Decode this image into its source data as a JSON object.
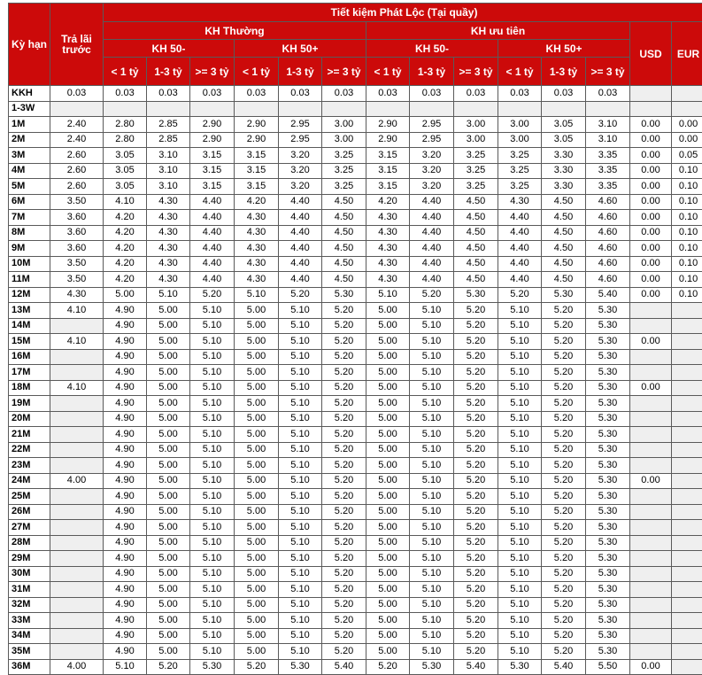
{
  "header": {
    "term": "Kỳ hạn",
    "prepaid": "Trả lãi trước",
    "product": "Tiết kiệm Phát Lộc (Tại quầy)",
    "normal": "KH Thường",
    "priority": "KH ưu tiên",
    "under50": "KH 50-",
    "over50": "KH 50+",
    "usd": "USD",
    "eur": "EUR",
    "lt1": "< 1 tỷ",
    "r13": "1-3 tỷ",
    "ge3": ">= 3 tỷ"
  },
  "rows": [
    {
      "term": "KKH",
      "prepaid": "0.03",
      "v": [
        "0.03",
        "0.03",
        "0.03",
        "0.03",
        "0.03",
        "0.03",
        "0.03",
        "0.03",
        "0.03",
        "0.03",
        "0.03",
        "0.03"
      ],
      "usd": "",
      "eur": ""
    },
    {
      "term": "1-3W",
      "prepaid": "",
      "v": [
        "",
        "",
        "",
        "",
        "",
        "",
        "",
        "",
        "",
        "",
        "",
        ""
      ],
      "usd": "",
      "eur": ""
    },
    {
      "term": "1M",
      "prepaid": "2.40",
      "v": [
        "2.80",
        "2.85",
        "2.90",
        "2.90",
        "2.95",
        "3.00",
        "2.90",
        "2.95",
        "3.00",
        "3.00",
        "3.05",
        "3.10"
      ],
      "usd": "0.00",
      "eur": "0.00"
    },
    {
      "term": "2M",
      "prepaid": "2.40",
      "v": [
        "2.80",
        "2.85",
        "2.90",
        "2.90",
        "2.95",
        "3.00",
        "2.90",
        "2.95",
        "3.00",
        "3.00",
        "3.05",
        "3.10"
      ],
      "usd": "0.00",
      "eur": "0.00"
    },
    {
      "term": "3M",
      "prepaid": "2.60",
      "v": [
        "3.05",
        "3.10",
        "3.15",
        "3.15",
        "3.20",
        "3.25",
        "3.15",
        "3.20",
        "3.25",
        "3.25",
        "3.30",
        "3.35"
      ],
      "usd": "0.00",
      "eur": "0.05"
    },
    {
      "term": "4M",
      "prepaid": "2.60",
      "v": [
        "3.05",
        "3.10",
        "3.15",
        "3.15",
        "3.20",
        "3.25",
        "3.15",
        "3.20",
        "3.25",
        "3.25",
        "3.30",
        "3.35"
      ],
      "usd": "0.00",
      "eur": "0.10"
    },
    {
      "term": "5M",
      "prepaid": "2.60",
      "v": [
        "3.05",
        "3.10",
        "3.15",
        "3.15",
        "3.20",
        "3.25",
        "3.15",
        "3.20",
        "3.25",
        "3.25",
        "3.30",
        "3.35"
      ],
      "usd": "0.00",
      "eur": "0.10"
    },
    {
      "term": "6M",
      "prepaid": "3.50",
      "v": [
        "4.10",
        "4.30",
        "4.40",
        "4.20",
        "4.40",
        "4.50",
        "4.20",
        "4.40",
        "4.50",
        "4.30",
        "4.50",
        "4.60"
      ],
      "usd": "0.00",
      "eur": "0.10"
    },
    {
      "term": "7M",
      "prepaid": "3.60",
      "v": [
        "4.20",
        "4.30",
        "4.40",
        "4.30",
        "4.40",
        "4.50",
        "4.30",
        "4.40",
        "4.50",
        "4.40",
        "4.50",
        "4.60"
      ],
      "usd": "0.00",
      "eur": "0.10"
    },
    {
      "term": "8M",
      "prepaid": "3.60",
      "v": [
        "4.20",
        "4.30",
        "4.40",
        "4.30",
        "4.40",
        "4.50",
        "4.30",
        "4.40",
        "4.50",
        "4.40",
        "4.50",
        "4.60"
      ],
      "usd": "0.00",
      "eur": "0.10"
    },
    {
      "term": "9M",
      "prepaid": "3.60",
      "v": [
        "4.20",
        "4.30",
        "4.40",
        "4.30",
        "4.40",
        "4.50",
        "4.30",
        "4.40",
        "4.50",
        "4.40",
        "4.50",
        "4.60"
      ],
      "usd": "0.00",
      "eur": "0.10"
    },
    {
      "term": "10M",
      "prepaid": "3.50",
      "v": [
        "4.20",
        "4.30",
        "4.40",
        "4.30",
        "4.40",
        "4.50",
        "4.30",
        "4.40",
        "4.50",
        "4.40",
        "4.50",
        "4.60"
      ],
      "usd": "0.00",
      "eur": "0.10"
    },
    {
      "term": "11M",
      "prepaid": "3.50",
      "v": [
        "4.20",
        "4.30",
        "4.40",
        "4.30",
        "4.40",
        "4.50",
        "4.30",
        "4.40",
        "4.50",
        "4.40",
        "4.50",
        "4.60"
      ],
      "usd": "0.00",
      "eur": "0.10"
    },
    {
      "term": "12M",
      "prepaid": "4.30",
      "v": [
        "5.00",
        "5.10",
        "5.20",
        "5.10",
        "5.20",
        "5.30",
        "5.10",
        "5.20",
        "5.30",
        "5.20",
        "5.30",
        "5.40"
      ],
      "usd": "0.00",
      "eur": "0.10"
    },
    {
      "term": "13M",
      "prepaid": "4.10",
      "v": [
        "4.90",
        "5.00",
        "5.10",
        "5.00",
        "5.10",
        "5.20",
        "5.00",
        "5.10",
        "5.20",
        "5.10",
        "5.20",
        "5.30"
      ],
      "usd": "",
      "eur": ""
    },
    {
      "term": "14M",
      "prepaid": "",
      "v": [
        "4.90",
        "5.00",
        "5.10",
        "5.00",
        "5.10",
        "5.20",
        "5.00",
        "5.10",
        "5.20",
        "5.10",
        "5.20",
        "5.30"
      ],
      "usd": "",
      "eur": ""
    },
    {
      "term": "15M",
      "prepaid": "4.10",
      "v": [
        "4.90",
        "5.00",
        "5.10",
        "5.00",
        "5.10",
        "5.20",
        "5.00",
        "5.10",
        "5.20",
        "5.10",
        "5.20",
        "5.30"
      ],
      "usd": "0.00",
      "eur": ""
    },
    {
      "term": "16M",
      "prepaid": "",
      "v": [
        "4.90",
        "5.00",
        "5.10",
        "5.00",
        "5.10",
        "5.20",
        "5.00",
        "5.10",
        "5.20",
        "5.10",
        "5.20",
        "5.30"
      ],
      "usd": "",
      "eur": ""
    },
    {
      "term": "17M",
      "prepaid": "",
      "v": [
        "4.90",
        "5.00",
        "5.10",
        "5.00",
        "5.10",
        "5.20",
        "5.00",
        "5.10",
        "5.20",
        "5.10",
        "5.20",
        "5.30"
      ],
      "usd": "",
      "eur": ""
    },
    {
      "term": "18M",
      "prepaid": "4.10",
      "v": [
        "4.90",
        "5.00",
        "5.10",
        "5.00",
        "5.10",
        "5.20",
        "5.00",
        "5.10",
        "5.20",
        "5.10",
        "5.20",
        "5.30"
      ],
      "usd": "0.00",
      "eur": ""
    },
    {
      "term": "19M",
      "prepaid": "",
      "v": [
        "4.90",
        "5.00",
        "5.10",
        "5.00",
        "5.10",
        "5.20",
        "5.00",
        "5.10",
        "5.20",
        "5.10",
        "5.20",
        "5.30"
      ],
      "usd": "",
      "eur": ""
    },
    {
      "term": "20M",
      "prepaid": "",
      "v": [
        "4.90",
        "5.00",
        "5.10",
        "5.00",
        "5.10",
        "5.20",
        "5.00",
        "5.10",
        "5.20",
        "5.10",
        "5.20",
        "5.30"
      ],
      "usd": "",
      "eur": ""
    },
    {
      "term": "21M",
      "prepaid": "",
      "v": [
        "4.90",
        "5.00",
        "5.10",
        "5.00",
        "5.10",
        "5.20",
        "5.00",
        "5.10",
        "5.20",
        "5.10",
        "5.20",
        "5.30"
      ],
      "usd": "",
      "eur": ""
    },
    {
      "term": "22M",
      "prepaid": "",
      "v": [
        "4.90",
        "5.00",
        "5.10",
        "5.00",
        "5.10",
        "5.20",
        "5.00",
        "5.10",
        "5.20",
        "5.10",
        "5.20",
        "5.30"
      ],
      "usd": "",
      "eur": ""
    },
    {
      "term": "23M",
      "prepaid": "",
      "v": [
        "4.90",
        "5.00",
        "5.10",
        "5.00",
        "5.10",
        "5.20",
        "5.00",
        "5.10",
        "5.20",
        "5.10",
        "5.20",
        "5.30"
      ],
      "usd": "",
      "eur": ""
    },
    {
      "term": "24M",
      "prepaid": "4.00",
      "v": [
        "4.90",
        "5.00",
        "5.10",
        "5.00",
        "5.10",
        "5.20",
        "5.00",
        "5.10",
        "5.20",
        "5.10",
        "5.20",
        "5.30"
      ],
      "usd": "0.00",
      "eur": ""
    },
    {
      "term": "25M",
      "prepaid": "",
      "v": [
        "4.90",
        "5.00",
        "5.10",
        "5.00",
        "5.10",
        "5.20",
        "5.00",
        "5.10",
        "5.20",
        "5.10",
        "5.20",
        "5.30"
      ],
      "usd": "",
      "eur": ""
    },
    {
      "term": "26M",
      "prepaid": "",
      "v": [
        "4.90",
        "5.00",
        "5.10",
        "5.00",
        "5.10",
        "5.20",
        "5.00",
        "5.10",
        "5.20",
        "5.10",
        "5.20",
        "5.30"
      ],
      "usd": "",
      "eur": ""
    },
    {
      "term": "27M",
      "prepaid": "",
      "v": [
        "4.90",
        "5.00",
        "5.10",
        "5.00",
        "5.10",
        "5.20",
        "5.00",
        "5.10",
        "5.20",
        "5.10",
        "5.20",
        "5.30"
      ],
      "usd": "",
      "eur": ""
    },
    {
      "term": "28M",
      "prepaid": "",
      "v": [
        "4.90",
        "5.00",
        "5.10",
        "5.00",
        "5.10",
        "5.20",
        "5.00",
        "5.10",
        "5.20",
        "5.10",
        "5.20",
        "5.30"
      ],
      "usd": "",
      "eur": ""
    },
    {
      "term": "29M",
      "prepaid": "",
      "v": [
        "4.90",
        "5.00",
        "5.10",
        "5.00",
        "5.10",
        "5.20",
        "5.00",
        "5.10",
        "5.20",
        "5.10",
        "5.20",
        "5.30"
      ],
      "usd": "",
      "eur": ""
    },
    {
      "term": "30M",
      "prepaid": "",
      "v": [
        "4.90",
        "5.00",
        "5.10",
        "5.00",
        "5.10",
        "5.20",
        "5.00",
        "5.10",
        "5.20",
        "5.10",
        "5.20",
        "5.30"
      ],
      "usd": "",
      "eur": ""
    },
    {
      "term": "31M",
      "prepaid": "",
      "v": [
        "4.90",
        "5.00",
        "5.10",
        "5.00",
        "5.10",
        "5.20",
        "5.00",
        "5.10",
        "5.20",
        "5.10",
        "5.20",
        "5.30"
      ],
      "usd": "",
      "eur": ""
    },
    {
      "term": "32M",
      "prepaid": "",
      "v": [
        "4.90",
        "5.00",
        "5.10",
        "5.00",
        "5.10",
        "5.20",
        "5.00",
        "5.10",
        "5.20",
        "5.10",
        "5.20",
        "5.30"
      ],
      "usd": "",
      "eur": ""
    },
    {
      "term": "33M",
      "prepaid": "",
      "v": [
        "4.90",
        "5.00",
        "5.10",
        "5.00",
        "5.10",
        "5.20",
        "5.00",
        "5.10",
        "5.20",
        "5.10",
        "5.20",
        "5.30"
      ],
      "usd": "",
      "eur": ""
    },
    {
      "term": "34M",
      "prepaid": "",
      "v": [
        "4.90",
        "5.00",
        "5.10",
        "5.00",
        "5.10",
        "5.20",
        "5.00",
        "5.10",
        "5.20",
        "5.10",
        "5.20",
        "5.30"
      ],
      "usd": "",
      "eur": ""
    },
    {
      "term": "35M",
      "prepaid": "",
      "v": [
        "4.90",
        "5.00",
        "5.10",
        "5.00",
        "5.10",
        "5.20",
        "5.00",
        "5.10",
        "5.20",
        "5.10",
        "5.20",
        "5.30"
      ],
      "usd": "",
      "eur": ""
    },
    {
      "term": "36M",
      "prepaid": "4.00",
      "v": [
        "5.10",
        "5.20",
        "5.30",
        "5.20",
        "5.30",
        "5.40",
        "5.20",
        "5.30",
        "5.40",
        "5.30",
        "5.40",
        "5.50"
      ],
      "usd": "0.00",
      "eur": ""
    }
  ],
  "colors": {
    "header_bg": "#cc0a0a",
    "header_text": "#ffffff",
    "alt_row": "#efefef",
    "border": "#5a5a5a"
  }
}
